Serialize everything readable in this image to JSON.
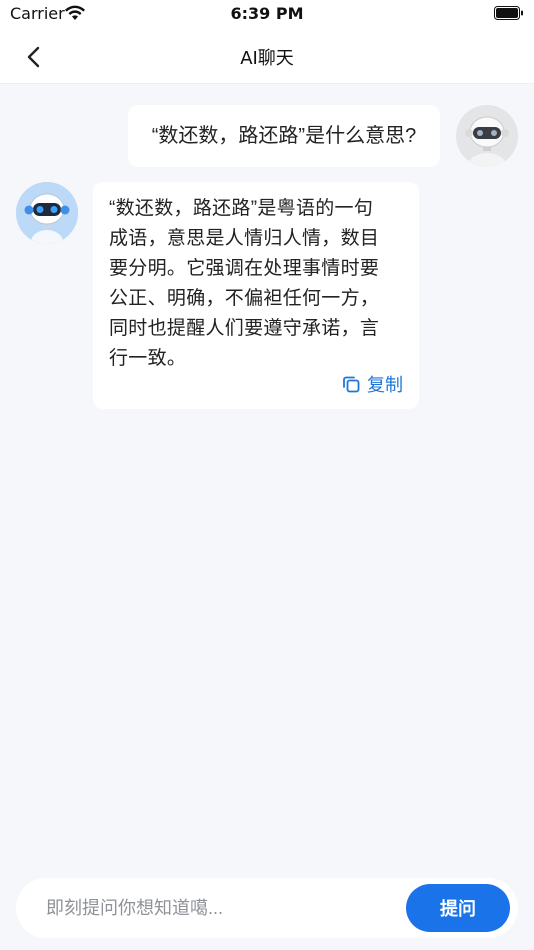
{
  "status_bar": {
    "carrier": "Carrier",
    "time": "6:39 PM"
  },
  "header": {
    "title": "AI聊天",
    "back_icon": "chevron-left-icon"
  },
  "messages": [
    {
      "role": "user",
      "avatar": "robot-avatar-gray",
      "text": "“数还数，路还路”是什么意思?"
    },
    {
      "role": "assistant",
      "avatar": "robot-avatar-blue",
      "lines": [
        "“数还数，路还路”是粤语的一句",
        "成语，意思是人情归人情，数目",
        "要分明。它强调在处理事情时要",
        "公正、明确，不偏袒任何一方，",
        "同时也提醒人们要遵守承诺，言",
        "行一致。"
      ],
      "copy_label": "复制",
      "copy_icon": "copy-icon"
    }
  ],
  "composer": {
    "placeholder": "即刻提问你想知道噶...",
    "value": "",
    "send_label": "提问"
  },
  "colors": {
    "accent": "#1a73e8",
    "link": "#1d76d8",
    "background": "#f5f7fa"
  }
}
